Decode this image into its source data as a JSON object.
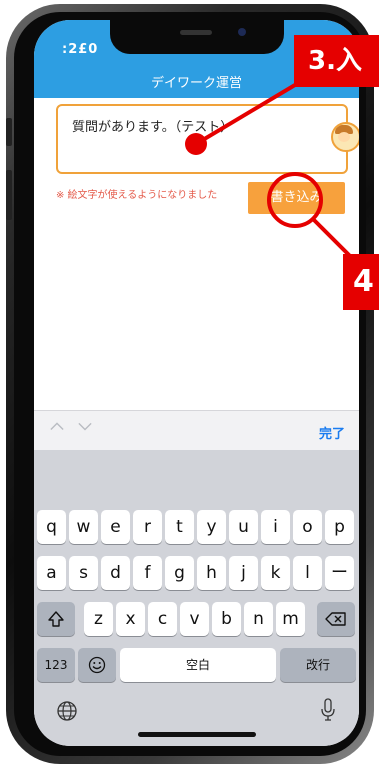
{
  "status_bar": {
    "time": ":2£0"
  },
  "header": {
    "title": "デイワーク運営"
  },
  "message_input": {
    "value": "質問があります。（テスト）"
  },
  "note": {
    "text": "※ 絵文字が使えるようになりました"
  },
  "write_button": {
    "label": "書き込み"
  },
  "accessory": {
    "done_label": "完了",
    "up_icon": "chevron-up-icon",
    "down_icon": "chevron-down-icon"
  },
  "keyboard": {
    "row1": [
      "q",
      "w",
      "e",
      "r",
      "t",
      "y",
      "u",
      "i",
      "o",
      "p"
    ],
    "row2": [
      "a",
      "s",
      "d",
      "f",
      "g",
      "h",
      "j",
      "k",
      "l",
      "ー"
    ],
    "row3": [
      "z",
      "x",
      "c",
      "v",
      "b",
      "n",
      "m"
    ],
    "shift_icon": "shift-icon",
    "delete_icon": "delete-icon",
    "numbers_label": "123",
    "emoji_icon": "emoji-icon",
    "space_label": "空白",
    "return_label": "改行",
    "globe_icon": "globe-icon",
    "mic_icon": "microphone-icon"
  },
  "callouts": {
    "step3": "3.入",
    "step4": "4"
  },
  "colors": {
    "header": "#2d9ee2",
    "accent_orange": "#f7a13d",
    "callout_red": "#e50000",
    "note_red": "#e45a4a",
    "done_blue": "#1a7cf0"
  }
}
